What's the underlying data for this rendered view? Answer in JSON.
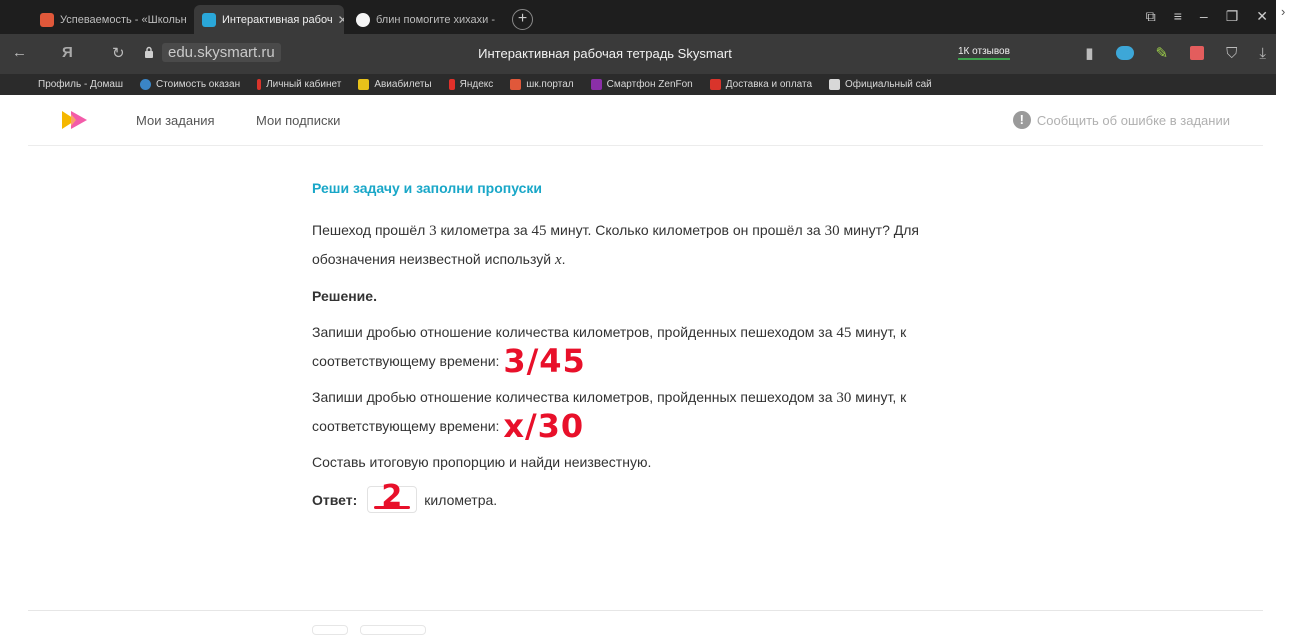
{
  "browser": {
    "tabs": [
      {
        "label": "Успеваемость - «Школьн",
        "active": false
      },
      {
        "label": "Интерактивная рабоч",
        "active": true
      },
      {
        "label": "блин помогите хихахи - ",
        "active": false
      }
    ],
    "new_tab": "+",
    "url": "edu.skysmart.ru",
    "page_title": "Интерактивная рабочая тетрадь Skysmart",
    "reviews": "1К отзывов",
    "bookmarks": [
      "Профиль - Домаш",
      "Стоимость оказан",
      "Личный кабинет",
      "Авиабилеты",
      "Яндекс",
      "шк.портал",
      "Смартфон ZenFon",
      "Доставка и оплата",
      "Официальный сай"
    ]
  },
  "header": {
    "nav": [
      "Мои задания",
      "Мои подписки"
    ],
    "report": "Сообщить об ошибке в задании"
  },
  "task": {
    "title": "Реши задачу и заполни пропуски",
    "problem_a": "Пешеход прошёл ",
    "n1": "3",
    "problem_b": " километра за ",
    "n2": "45",
    "problem_c": " минут. Сколько километров он прошёл за ",
    "n3": "30",
    "problem_d": " минут? Для обозначения неизвестной используй ",
    "var": "x",
    "problem_e": ".",
    "solution_label": "Решение.",
    "step1_a": "Запиши дробью отношение количества километров, пройденных пешеходом за ",
    "step1_n": "45",
    "step1_b": " минут, к соответствующему времени:",
    "step1_hand": "3/45",
    "step2_a": "Запиши дробью отношение количества километров, пройденных пешеходом за ",
    "step2_n": "30",
    "step2_b": " минут, к соответствующему времени:",
    "step2_hand": "x/30",
    "step3": "Составь итоговую пропорцию и найди неизвестную.",
    "answer_label": "Ответ:",
    "answer_hand": "2",
    "answer_unit": "километра."
  },
  "colors": {
    "accent": "#19a7c8",
    "handwriting": "#e8102a"
  }
}
